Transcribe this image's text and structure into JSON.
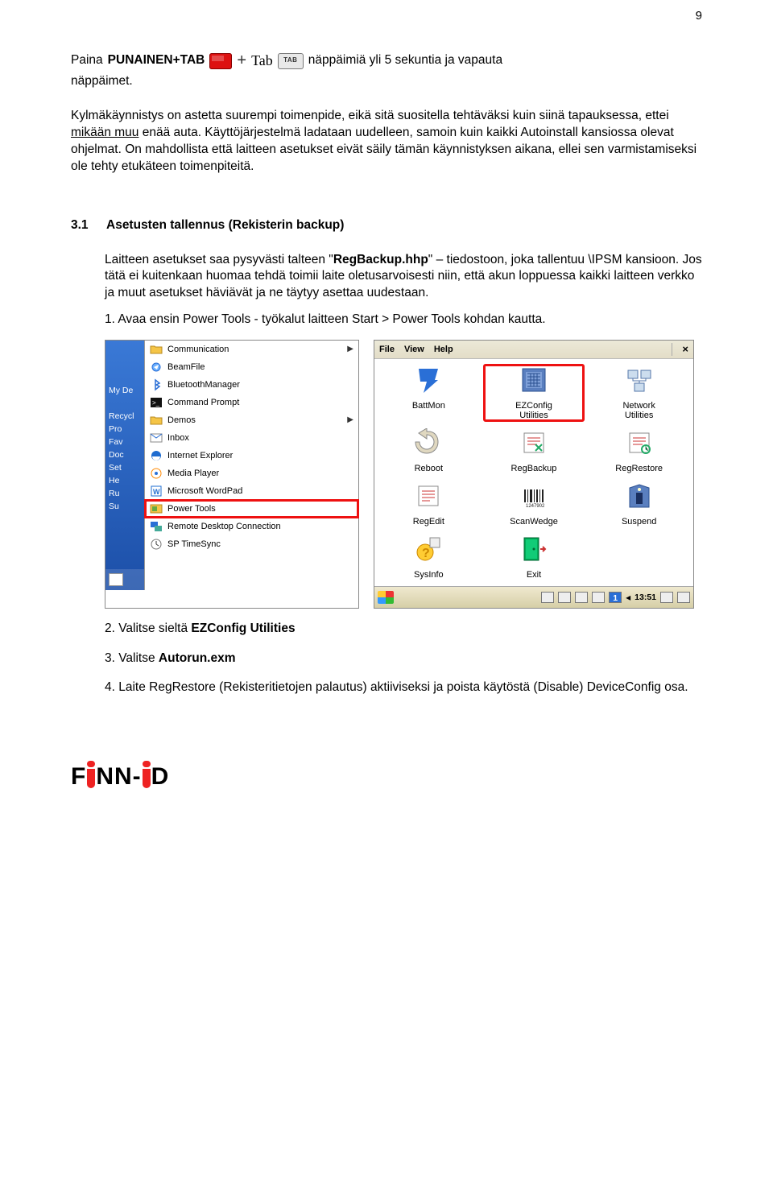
{
  "page_number": "9",
  "lead": {
    "prefix": "Paina ",
    "bold_combo": "PUNAINEN+TAB",
    "plus": " + ",
    "tab_word": "Tab",
    "tab_key": "TAB",
    "tail": " näppäimiä yli 5 sekuntia ja vapauta",
    "line2": "näppäimet."
  },
  "para1": "Kylmäkäynnistys on astetta suurempi toimenpide, eikä sitä suositella tehtäväksi kuin siinä tapauksessa, ettei mikään muu enää auta. Käyttöjärjestelmä ladataan uudelleen, samoin kuin kaikki Autoinstall kansiossa olevat ohjelmat. On mahdollista että laitteen asetukset eivät säily tämän käynnistyksen aikana, ellei sen varmistamiseksi ole tehty etukäteen toimenpiteitä.",
  "para1_underlined": "mikään muu",
  "section": {
    "num": "3.1",
    "title": "Asetusten tallennus (Rekisterin backup)"
  },
  "para2_a": "Laitteen asetukset saa pysyvästi talteen \"",
  "para2_bold1": "RegBackup.hhp",
  "para2_b": "\" – tiedostoon, joka tallentuu \\IPSM kansioon. Jos tätä ei kuitenkaan huomaa tehdä toimii laite oletusarvoisesti niin, että akun loppuessa kaikki laitteen verkko ja muut asetukset häviävät ja ne täytyy asettaa uudestaan.",
  "step1": "1. Avaa ensin Power Tools - työkalut laitteen Start > Power Tools kohdan kautta.",
  "left_shot": {
    "cut_items": [
      "My De",
      "",
      "Recycl",
      "Pro",
      "Fav",
      "Doc",
      "Set",
      "He",
      "Ru",
      "Su"
    ],
    "menu": [
      {
        "label": "Communication",
        "arrow": true
      },
      {
        "label": "BeamFile"
      },
      {
        "label": "BluetoothManager"
      },
      {
        "label": "Command Prompt"
      },
      {
        "label": "Demos",
        "arrow": true
      },
      {
        "label": "Inbox"
      },
      {
        "label": "Internet Explorer"
      },
      {
        "label": "Media Player"
      },
      {
        "label": "Microsoft WordPad"
      },
      {
        "label": "Power Tools",
        "highlight": true
      },
      {
        "label": "Remote Desktop Connection"
      },
      {
        "label": "SP TimeSync"
      }
    ]
  },
  "right_shot": {
    "menubar": [
      "File",
      "View",
      "Help"
    ],
    "icons": [
      {
        "name": "BattMon"
      },
      {
        "name": "EZConfig Utilities",
        "highlight": true
      },
      {
        "name": "Network Utilities"
      },
      {
        "name": "Reboot"
      },
      {
        "name": "RegBackup"
      },
      {
        "name": "RegRestore"
      },
      {
        "name": "RegEdit"
      },
      {
        "name": "ScanWedge"
      },
      {
        "name": "Suspend"
      },
      {
        "name": "SysInfo"
      },
      {
        "name": "Exit"
      }
    ],
    "clock": "13:51"
  },
  "step2_a": "2. Valitse sieltä ",
  "step2_b": "EZConfig Utilities",
  "step3_a": "3. Valitse ",
  "step3_b": "Autorun.exm",
  "step4": "4. Laite RegRestore (Rekisteritietojen palautus) aktiiviseksi ja poista käytöstä (Disable) DeviceConfig osa.",
  "logo": {
    "pre": "F",
    "post": "NN-",
    "tail": "D"
  }
}
